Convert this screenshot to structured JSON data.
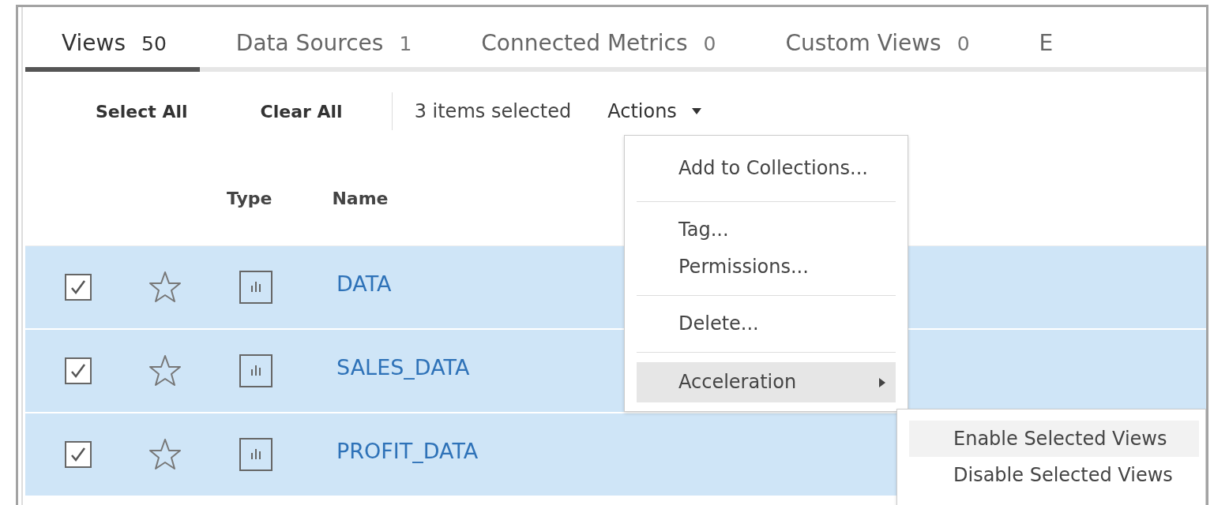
{
  "tabs": [
    {
      "label": "Views",
      "count": "50",
      "selected": true
    },
    {
      "label": "Data Sources",
      "count": "1",
      "selected": false
    },
    {
      "label": "Connected Metrics",
      "count": "0",
      "selected": false
    },
    {
      "label": "Custom Views",
      "count": "0",
      "selected": false
    },
    {
      "label": "E",
      "selected": false
    }
  ],
  "toolbar": {
    "select_all": "Select All",
    "clear_all": "Clear All",
    "selection_count": "3 items selected",
    "actions": "Actions"
  },
  "columns": [
    "Type",
    "Name"
  ],
  "rows": [
    {
      "checked": true,
      "name": "DATA"
    },
    {
      "checked": true,
      "name": "SALES_DATA"
    },
    {
      "checked": true,
      "name": "PROFIT_DATA"
    }
  ],
  "menu": {
    "groups": [
      {
        "items": [
          {
            "label": "Add to Collections...",
            "selected": false
          }
        ]
      },
      {
        "items": [
          {
            "label": "Tag...",
            "selected": false
          },
          {
            "label": "Permissions...",
            "selected": false
          }
        ]
      },
      {
        "items": [
          {
            "label": "Delete...",
            "selected": false
          }
        ]
      },
      {
        "items": [
          {
            "label": "Acceleration",
            "selected": true,
            "has_submenu": true
          }
        ]
      }
    ]
  },
  "submenu": {
    "items": [
      {
        "label": "Enable Selected Views",
        "selected": true
      },
      {
        "label": "Disable Selected Views",
        "selected": false
      }
    ]
  }
}
